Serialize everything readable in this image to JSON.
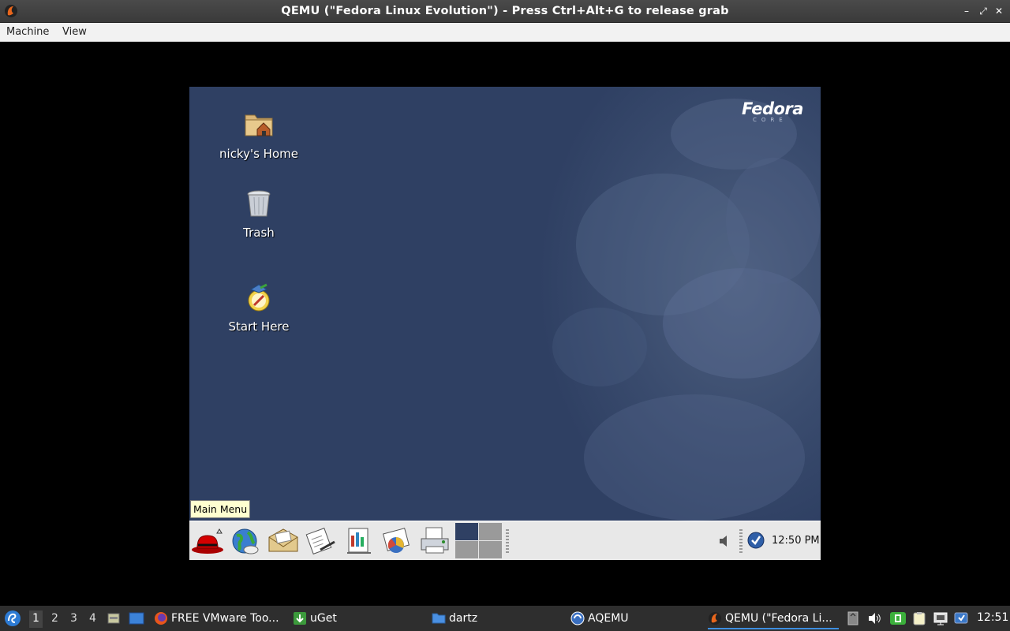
{
  "window": {
    "title": "QEMU (\"Fedora Linux Evolution\") - Press Ctrl+Alt+G to release grab",
    "controls": [
      "minimize",
      "maximize",
      "close"
    ]
  },
  "menubar": {
    "items": [
      "Machine",
      "View"
    ]
  },
  "guest": {
    "logo": "Fedora",
    "logo_sub": "CORE",
    "desktop_icons": [
      {
        "label": "nicky's Home",
        "icon": "home-folder-icon"
      },
      {
        "label": "Trash",
        "icon": "trash-icon"
      },
      {
        "label": "Start Here",
        "icon": "start-here-icon"
      }
    ],
    "tooltip": "Main Menu",
    "panel": {
      "launchers": [
        "main-menu-redhat-icon",
        "web-browser-icon",
        "email-icon",
        "writer-icon",
        "impress-icon",
        "calc-icon",
        "print-manager-icon"
      ],
      "clock": "12:50 PM"
    }
  },
  "taskbar": {
    "workspaces": [
      "1",
      "2",
      "3",
      "4"
    ],
    "active_workspace": "1",
    "tasks": [
      {
        "label": "FREE VMware Too...",
        "icon": "firefox-icon"
      },
      {
        "label": "uGet",
        "icon": "uget-icon"
      },
      {
        "label": "dartz",
        "icon": "folder-icon"
      },
      {
        "label": "AQEMU",
        "icon": "aqemu-icon"
      },
      {
        "label": "QEMU (\"Fedora Li...",
        "icon": "qemu-icon",
        "active": true
      }
    ],
    "clock": "12:51"
  },
  "colors": {
    "guest_background": "#2f4063",
    "panel": "#e8e8e8",
    "taskbar": "#2e2e2e",
    "active_task_underline": "#3d8ee0"
  }
}
